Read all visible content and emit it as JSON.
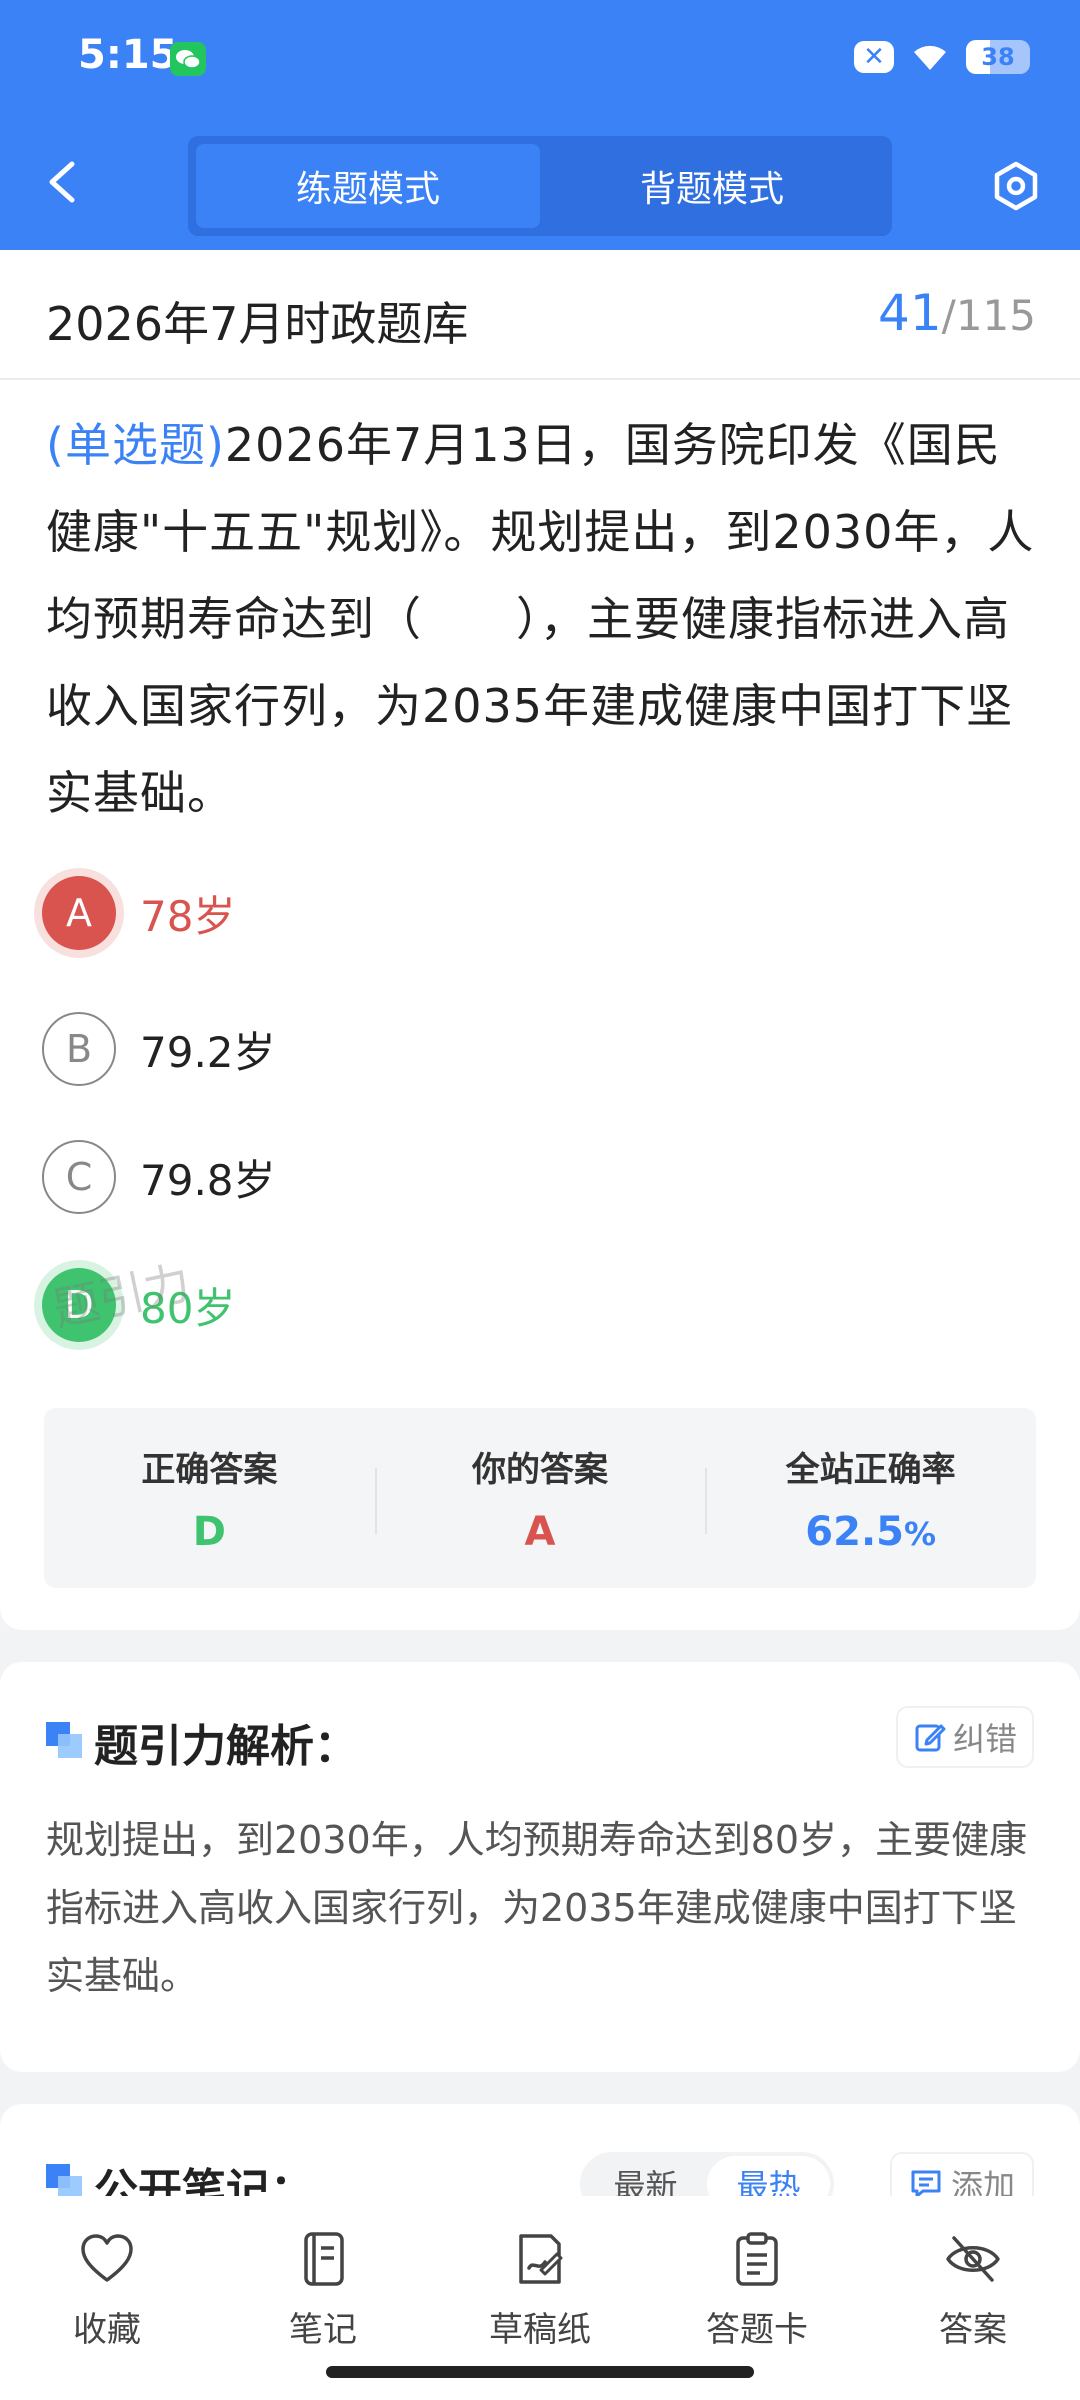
{
  "status_bar": {
    "time": "5:15",
    "battery": "38",
    "close_badge": "✕"
  },
  "header": {
    "modes": [
      "练题模式",
      "背题模式"
    ],
    "active_mode": "练题模式"
  },
  "question_bank": {
    "title": "2026年7月时政题库",
    "current": "41",
    "separator": "/",
    "total": "115"
  },
  "question": {
    "type": "(单选题)",
    "text": "2026年7月13日，国务院印发《国民健康\"十五五\"规划》。规划提出，到2030年，人均预期寿命达到（　　），主要健康指标进入高收入国家行列，为2035年建成健康中国打下坚实基础。"
  },
  "options": [
    {
      "letter": "A",
      "text": "78岁",
      "state": "wrong"
    },
    {
      "letter": "B",
      "text": "79.2岁",
      "state": "normal"
    },
    {
      "letter": "C",
      "text": "79.8岁",
      "state": "normal"
    },
    {
      "letter": "D",
      "text": "80岁",
      "state": "correct"
    }
  ],
  "watermark": "题引力",
  "answer_summary": {
    "correct_label": "正确答案",
    "correct_value": "D",
    "yours_label": "你的答案",
    "yours_value": "A",
    "rate_label": "全站正确率",
    "rate_value": "62.5",
    "rate_unit": "%"
  },
  "analysis": {
    "title": "题引力解析：",
    "report_label": "纠错",
    "text": "规划提出，到2030年，人均预期寿命达到80岁，主要健康指标进入高收入国家行列，为2035年建成健康中国打下坚实基础。"
  },
  "notes": {
    "title": "公开笔记：",
    "sort_options": [
      "最新",
      "最热"
    ],
    "active_sort": "最热",
    "add_label": "添加"
  },
  "bottom_nav": [
    {
      "label": "收藏",
      "icon": "heart-icon"
    },
    {
      "label": "笔记",
      "icon": "notebook-icon"
    },
    {
      "label": "草稿纸",
      "icon": "draft-icon"
    },
    {
      "label": "答题卡",
      "icon": "clipboard-icon"
    },
    {
      "label": "答案",
      "icon": "eye-off-icon"
    }
  ],
  "colors": {
    "primary": "#3b82f6",
    "wrong": "#d9534f",
    "correct": "#3fc36f"
  }
}
